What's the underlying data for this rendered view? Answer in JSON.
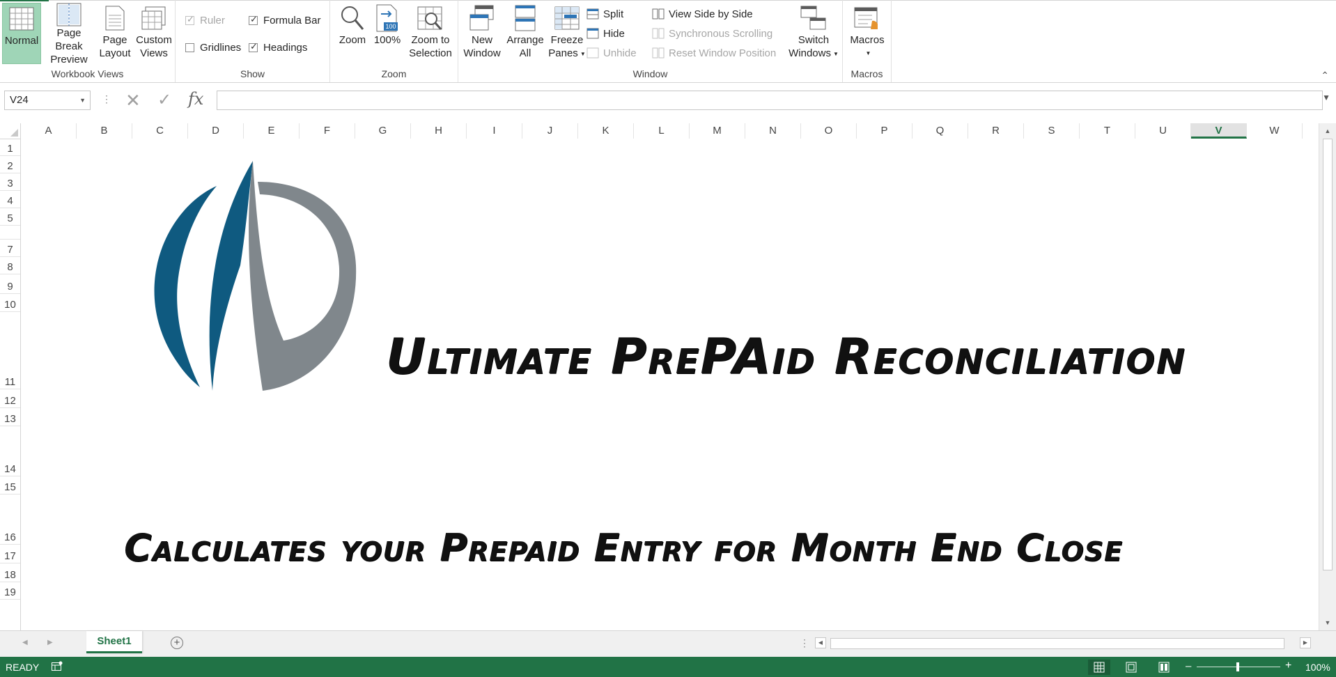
{
  "ribbon": {
    "workbook_views": {
      "label": "Workbook Views",
      "normal": "Normal",
      "page_break_l1": "Page Break",
      "page_break_l2": "Preview",
      "page_layout_l1": "Page",
      "page_layout_l2": "Layout",
      "custom_views_l1": "Custom",
      "custom_views_l2": "Views"
    },
    "show": {
      "label": "Show",
      "ruler": "Ruler",
      "gridlines": "Gridlines",
      "formula_bar": "Formula Bar",
      "headings": "Headings"
    },
    "zoom": {
      "label": "Zoom",
      "zoom": "Zoom",
      "hundred": "100%",
      "hundred_icon_text": "100",
      "zoom_sel_l1": "Zoom to",
      "zoom_sel_l2": "Selection"
    },
    "window": {
      "label": "Window",
      "new_window_l1": "New",
      "new_window_l2": "Window",
      "arrange_l1": "Arrange",
      "arrange_l2": "All",
      "freeze_l1": "Freeze",
      "freeze_l2": "Panes",
      "split": "Split",
      "hide": "Hide",
      "unhide": "Unhide",
      "view_side": "View Side by Side",
      "sync_scroll": "Synchronous Scrolling",
      "reset_pos": "Reset Window Position",
      "switch_l1": "Switch",
      "switch_l2": "Windows"
    },
    "macros": {
      "label": "Macros",
      "macros": "Macros"
    },
    "collapse_icon": "⌃"
  },
  "formula_bar": {
    "name_box": "V24",
    "formula": ""
  },
  "grid": {
    "columns": [
      "A",
      "B",
      "C",
      "D",
      "E",
      "F",
      "G",
      "H",
      "I",
      "J",
      "K",
      "L",
      "M",
      "N",
      "O",
      "P",
      "Q",
      "R",
      "S",
      "T",
      "U",
      "V",
      "W"
    ],
    "selected_column": "V",
    "rows": [
      "1",
      "2",
      "3",
      "4",
      "5",
      "",
      "7",
      "8",
      "9",
      "10",
      "11",
      "12",
      "13",
      "14",
      "15",
      "16",
      "17",
      "18",
      "19"
    ]
  },
  "content": {
    "title": "Ultimate PrePAid Reconciliation",
    "subtitle": "Calculates your Prepaid Entry for Month End Close"
  },
  "sheet_tabs": {
    "active": "Sheet1",
    "add_icon": "+"
  },
  "status_bar": {
    "status": "READY",
    "zoom_minus": "–",
    "zoom_plus": "+",
    "zoom": "100%"
  },
  "colors": {
    "excel_green": "#217346",
    "logo_blue": "#0f5a80",
    "logo_gray": "#80878c"
  }
}
